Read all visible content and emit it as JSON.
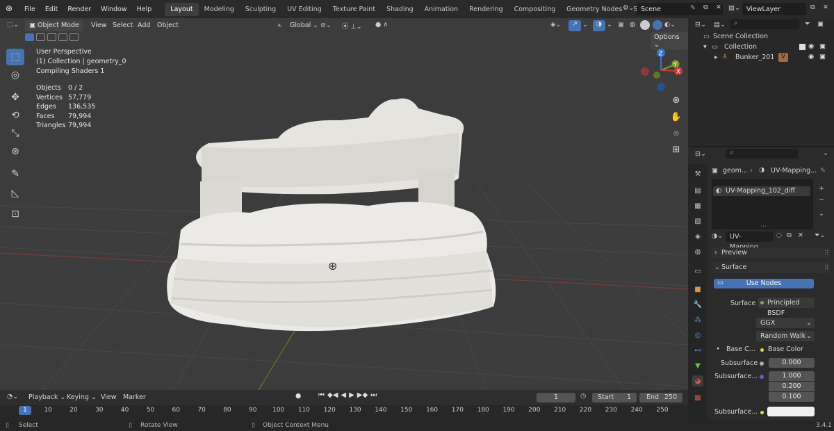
{
  "topbar": {
    "menus": [
      "File",
      "Edit",
      "Render",
      "Window",
      "Help"
    ],
    "workspaces": [
      "Layout",
      "Modeling",
      "Sculpting",
      "UV Editing",
      "Texture Paint",
      "Shading",
      "Animation",
      "Rendering",
      "Compositing",
      "Geometry Nodes",
      "Scripting"
    ],
    "add_symbol": "+",
    "scene": "Scene",
    "view_layer": "ViewLayer"
  },
  "viewport": {
    "mode": "Object Mode",
    "menus": [
      "View",
      "Select",
      "Add",
      "Object"
    ],
    "transform": "Global",
    "options": "Options",
    "overlay": {
      "line1": "User Perspective",
      "line2": "(1) Collection | geometry_0",
      "line3": "Compiling Shaders 1"
    },
    "stats": [
      {
        "label": "Objects",
        "value": "0 / 2"
      },
      {
        "label": "Vertices",
        "value": "57,779"
      },
      {
        "label": "Edges",
        "value": "136,535"
      },
      {
        "label": "Faces",
        "value": "79,994"
      },
      {
        "label": "Triangles",
        "value": "79,994"
      }
    ],
    "gizmo": {
      "z": "Z",
      "y": "Y",
      "x": "X"
    }
  },
  "outliner": {
    "root": "Scene Collection",
    "collection": "Collection",
    "object": "Bunker_201"
  },
  "properties": {
    "breadcrumb_obj": "geom...",
    "breadcrumb_mat": "UV-Mapping...",
    "slot": "UV-Mapping_102_diff",
    "material_name": "UV-Mapping_...",
    "preview": "Preview",
    "surface_panel": "Surface",
    "use_nodes": "Use Nodes",
    "rows": {
      "surface_label": "Surface",
      "surface_value": "Principled BSDF",
      "dist": "GGX",
      "sss_method": "Random Walk",
      "base_color_label": "Base C...",
      "base_color_value": "Base Color",
      "subsurface_label": "Subsurface",
      "subsurface_value": "0.000",
      "radius_label": "Subsurface...",
      "radius": [
        "1.000",
        "0.200",
        "0.100"
      ],
      "sss_color_label": "Subsurface..."
    }
  },
  "timeline": {
    "menus": [
      "Playback",
      "Keying",
      "View",
      "Marker"
    ],
    "current_frame": "1",
    "start_label": "Start",
    "start": "1",
    "end_label": "End",
    "end": "250",
    "ticks": [
      "1",
      "10",
      "20",
      "30",
      "40",
      "50",
      "60",
      "70",
      "80",
      "90",
      "100",
      "110",
      "120",
      "130",
      "140",
      "150",
      "160",
      "170",
      "180",
      "190",
      "200",
      "210",
      "220",
      "230",
      "240",
      "250"
    ]
  },
  "status": {
    "select": "Select",
    "rotate": "Rotate View",
    "context": "Object Context Menu",
    "version": "3.4.1"
  }
}
